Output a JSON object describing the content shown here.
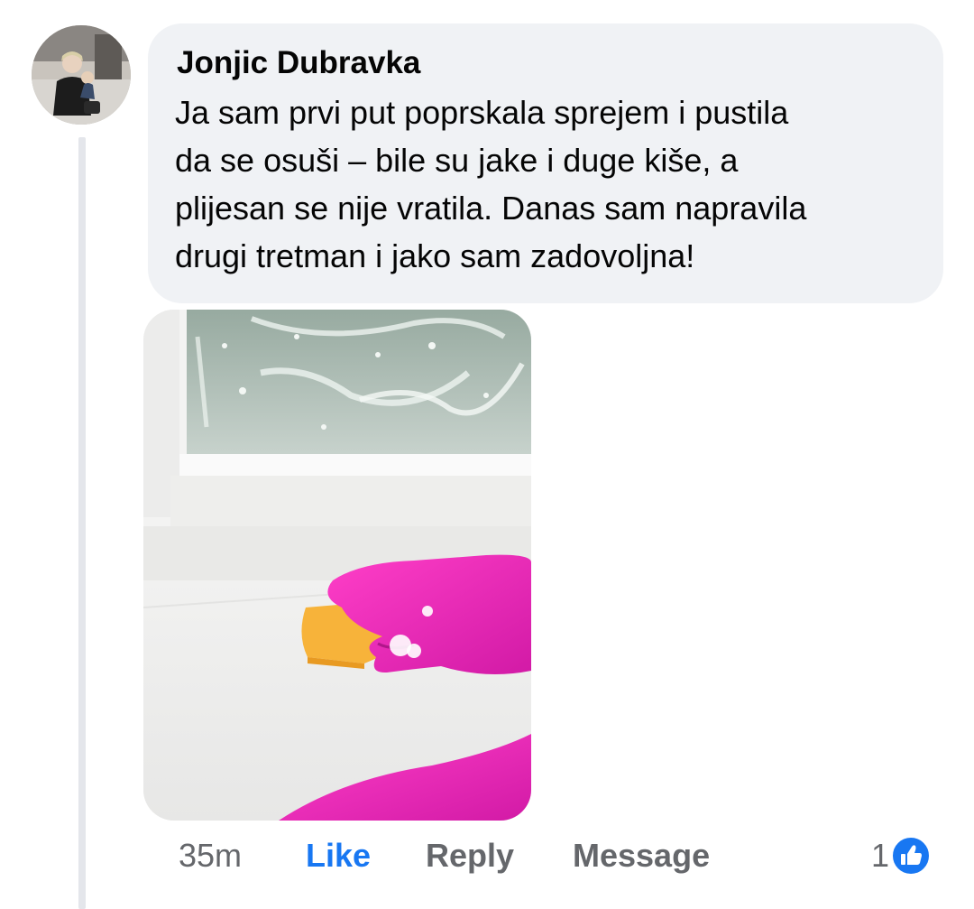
{
  "comment": {
    "author": "Jonjic Dubravka",
    "text_lines": [
      "Ja sam prvi put poprskala sprejem i pustila",
      "da se osuši – bile su jake i duge kiše, a",
      "plijesan se nije vratila. Danas sam napravila",
      "drugi tretman i jako sam zadovoljna!"
    ]
  },
  "actions": {
    "time": "35m",
    "like_label": "Like",
    "reply_label": "Reply",
    "message_label": "Message",
    "reaction_count": "1",
    "reaction_icon": "like-thumbs-up-icon"
  },
  "colors": {
    "bubble_bg": "#f0f2f5",
    "like_active": "#1877f2",
    "meta_text": "#65676b",
    "thread_line": "#e4e6eb"
  }
}
